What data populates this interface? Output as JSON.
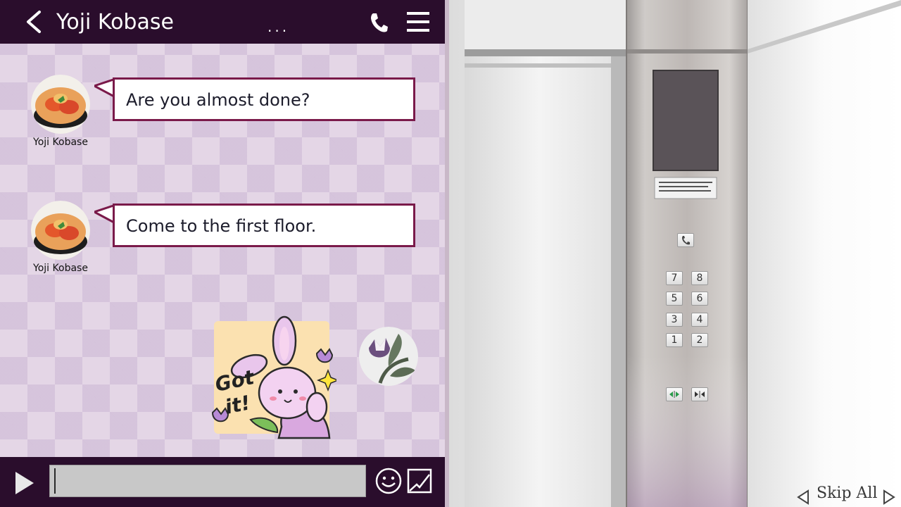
{
  "header": {
    "contact_name": "Yoji Kobase",
    "typing_indicator": "..."
  },
  "messages": [
    {
      "sender": "Yoji Kobase",
      "text": "Are you almost done?"
    },
    {
      "sender": "Yoji Kobase",
      "text": "Come to the first floor."
    }
  ],
  "sticker": {
    "text_line1": "Got",
    "text_line2": "it!"
  },
  "input": {
    "value": ""
  },
  "elevator": {
    "floor_buttons": [
      "7",
      "8",
      "5",
      "6",
      "3",
      "4",
      "1",
      "2"
    ],
    "call_button_icon": "phone-icon",
    "door_buttons": [
      "door-open-icon",
      "door-close-icon"
    ]
  },
  "controls": {
    "skip_all_label": "Skip All"
  },
  "colors": {
    "header_bg": "#2a0d2c",
    "bubble_border": "#7a1a4a",
    "chat_bg": "#e4d6e6"
  }
}
